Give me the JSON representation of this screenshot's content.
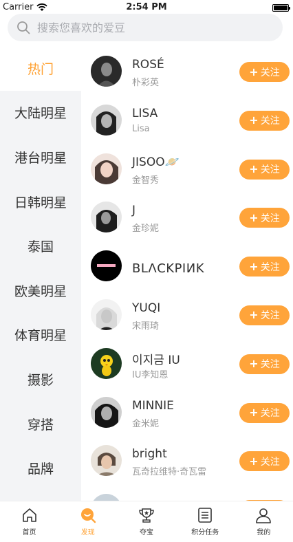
{
  "status": {
    "carrier": "Carrier",
    "time": "2:54 PM"
  },
  "search": {
    "placeholder": "搜索您喜欢的爱豆"
  },
  "sidebar": {
    "items": [
      {
        "label": "热门",
        "active": true
      },
      {
        "label": "大陆明星"
      },
      {
        "label": "港台明星"
      },
      {
        "label": "日韩明星"
      },
      {
        "label": "泰国"
      },
      {
        "label": "欧美明星"
      },
      {
        "label": "体育明星"
      },
      {
        "label": "摄影"
      },
      {
        "label": "穿搭"
      },
      {
        "label": "品牌"
      }
    ]
  },
  "list": {
    "follow_label": "关注",
    "items": [
      {
        "name": "ROSÉ",
        "sub": "朴彩英"
      },
      {
        "name": "LISA",
        "sub": "Lisa"
      },
      {
        "name": "JISOO🪐",
        "sub": "金智秀"
      },
      {
        "name": "J",
        "sub": "金珍妮"
      },
      {
        "name": "BLΛCKPIИK",
        "sub": ""
      },
      {
        "name": "YUQI",
        "sub": "宋雨琦"
      },
      {
        "name": "이지금 IU",
        "sub": "IU李知恩"
      },
      {
        "name": "MINNIE",
        "sub": "金米妮"
      },
      {
        "name": "bright",
        "sub": "瓦奇拉维特·奇瓦雷"
      }
    ]
  },
  "tabbar": {
    "items": [
      {
        "label": "首页",
        "icon": "home-icon"
      },
      {
        "label": "发现",
        "icon": "discover-icon",
        "active": true
      },
      {
        "label": "夺宝",
        "icon": "trophy-icon"
      },
      {
        "label": "积分任务",
        "icon": "task-list-icon"
      },
      {
        "label": "我的",
        "icon": "profile-icon"
      }
    ]
  },
  "colors": {
    "accent": "#ffa43a",
    "sidebar_bg": "#f3f4f6",
    "active_text": "#ff9f2e"
  }
}
